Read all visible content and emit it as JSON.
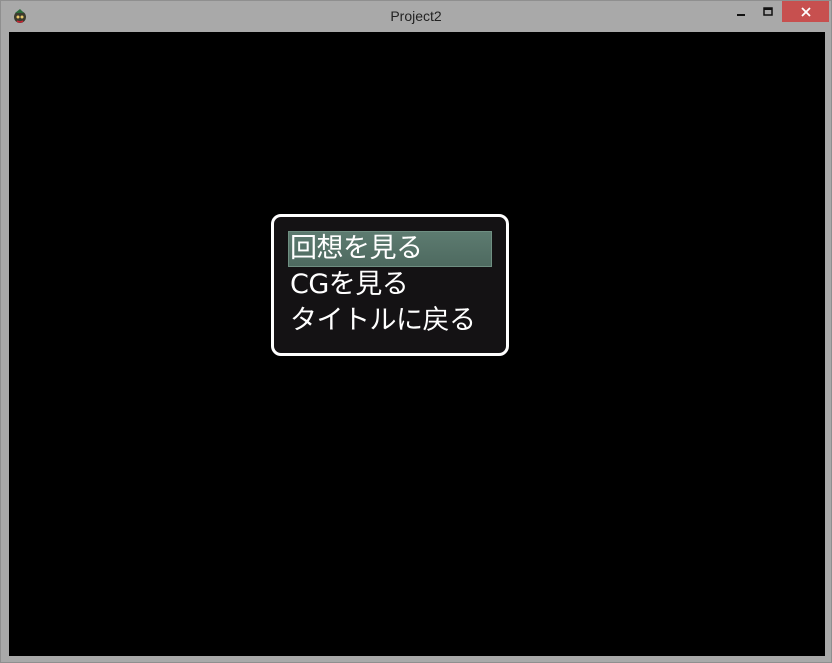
{
  "window": {
    "title": "Project2",
    "icon": "app-icon"
  },
  "titlebar_controls": {
    "minimize": "minimize-icon",
    "maximize": "maximize-icon",
    "close": "close-icon",
    "close_color": "#c7504f"
  },
  "menu": {
    "selected_index": 0,
    "highlight_color": "#5d7b70",
    "items": [
      {
        "label": "回想を見る"
      },
      {
        "label": "CGを見る"
      },
      {
        "label": "タイトルに戻る"
      }
    ]
  }
}
